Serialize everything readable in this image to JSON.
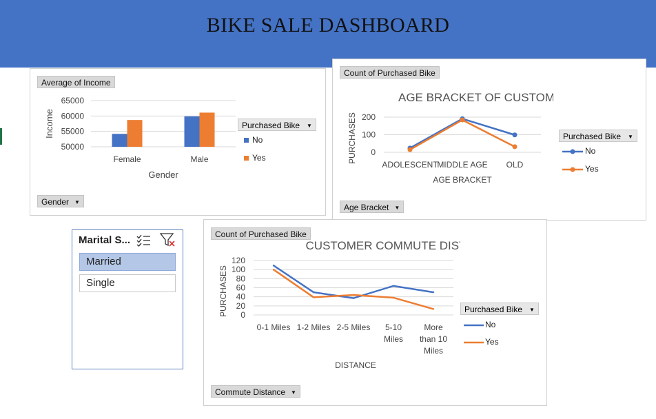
{
  "dashboard": {
    "title": "BIKE SALE DASHBOARD"
  },
  "colors": {
    "banner": "#4472c4",
    "series_no": "#4472c4",
    "series_yes": "#ed7d31"
  },
  "charts": {
    "income": {
      "value_button": "Average of Income",
      "axis_button": "Gender",
      "legend_title": "Purchased Bike",
      "xlabel": "Gender",
      "ylabel": "Income"
    },
    "age": {
      "value_button": "Count of Purchased Bike",
      "axis_button": "Age Bracket",
      "title": "AGE BRACKET OF CUSTOMERS",
      "legend_title": "Purchased Bike",
      "xlabel": "AGE BRACKET",
      "ylabel": "PURCHASES"
    },
    "commute": {
      "value_button": "Count of Purchased Bike",
      "axis_button": "Commute Distance",
      "title": "CUSTOMER COMMUTE DISTANCE",
      "legend_title": "Purchased Bike",
      "xlabel": "DISTANCE",
      "ylabel": "PURCHASES"
    }
  },
  "slicer": {
    "title": "Marital S...",
    "items": [
      {
        "label": "Married",
        "selected": true
      },
      {
        "label": "Single",
        "selected": false
      }
    ],
    "multiselect_icon": "multi-select-icon",
    "clear_filter_icon": "clear-filter-icon"
  },
  "chart_data": [
    {
      "type": "bar",
      "categories": [
        "Female",
        "Male"
      ],
      "series": [
        {
          "name": "No",
          "values": [
            54200,
            59900
          ]
        },
        {
          "name": "Yes",
          "values": [
            58700,
            61100
          ]
        }
      ],
      "xlabel": "Gender",
      "ylabel": "Income",
      "ylim": [
        50000,
        65000
      ],
      "yticks": [
        "65000",
        "60000",
        "55000",
        "50000"
      ],
      "grid": true,
      "legend_position": "right"
    },
    {
      "type": "line",
      "title": "AGE BRACKET OF CUSTOMERS",
      "categories": [
        "ADOLESCENT",
        "MIDDLE AGE",
        "OLD"
      ],
      "series": [
        {
          "name": "No",
          "values": [
            24,
            191,
            99
          ]
        },
        {
          "name": "Yes",
          "values": [
            15,
            184,
            32
          ]
        }
      ],
      "xlabel": "AGE BRACKET",
      "ylabel": "PURCHASES",
      "ylim": [
        0,
        200
      ],
      "yticks": [
        "200",
        "100",
        "0"
      ],
      "grid": true,
      "legend_position": "right"
    },
    {
      "type": "line",
      "title": "CUSTOMER COMMUTE DISTANCE",
      "categories": [
        [
          "0-1 Miles"
        ],
        [
          "1-2 Miles"
        ],
        [
          "2-5 Miles"
        ],
        [
          "5-10",
          "Miles"
        ],
        [
          "More",
          "than 10",
          "Miles"
        ]
      ],
      "series": [
        {
          "name": "No",
          "values": [
            109,
            50,
            37,
            64,
            50
          ]
        },
        {
          "name": "Yes",
          "values": [
            100,
            39,
            44,
            38,
            13
          ]
        }
      ],
      "xlabel": "DISTANCE",
      "ylabel": "PURCHASES",
      "ylim": [
        0,
        120
      ],
      "yticks": [
        "120",
        "100",
        "80",
        "60",
        "40",
        "20",
        "0"
      ],
      "grid": true,
      "legend_position": "right"
    }
  ]
}
